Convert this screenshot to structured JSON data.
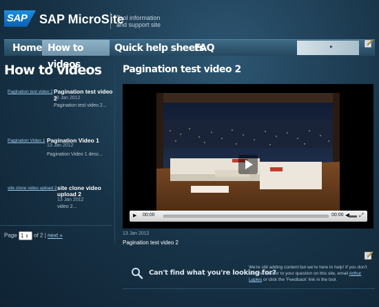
{
  "header": {
    "logo_text": "SAP",
    "site_title": "SAP MicroSite",
    "tagline_line1": "Tool information",
    "tagline_line2": "and support site"
  },
  "nav": {
    "items": [
      {
        "label": "Home"
      },
      {
        "label": "How to videos"
      },
      {
        "label": "Quick help sheets"
      },
      {
        "label": "FAQ"
      }
    ],
    "active": "How to videos"
  },
  "sidebar": {
    "title": "How to videos",
    "videos": [
      {
        "thumb_link": "Pagination test video 2",
        "title": "Pagination test video 2",
        "date": "13 Jan 2012",
        "desc": "Pagination test video 2..."
      },
      {
        "thumb_link": "Pagination Video 1",
        "title": "Pagination Video 1",
        "date": "13 Jan 2012",
        "desc": "Pagination Video 1 desc..."
      },
      {
        "thumb_link": "site clone video upload 2",
        "title_line1": "site clone video",
        "title_line2": "upload 2",
        "date": "13 Jan 2012",
        "desc": "video 2..."
      }
    ],
    "pager": {
      "prefix": "Page",
      "current": "1",
      "of_text": "of 2 |",
      "next": "next »"
    }
  },
  "main": {
    "title": "Pagination test video 2",
    "player": {
      "current_time": "00:00",
      "duration": "00:00"
    },
    "date": "13 Jan 2012",
    "caption": "Pagination test video 2"
  },
  "help": {
    "heading": "Can't find what you're looking for?",
    "text_part1": "We're still adding content but we're here to help! If you don't see the answer to your question on this site, email ",
    "contact_name": "Arthur Laples",
    "text_part2": " or click the 'Feedback' link in the tool."
  },
  "colors": {
    "accent_link": "#9fd0ef",
    "nav_active": "#8fb2c6",
    "background": "#173246"
  }
}
